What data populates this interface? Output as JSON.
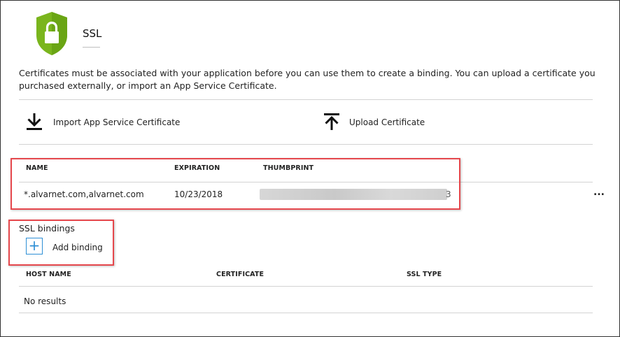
{
  "header": {
    "title": "SSL",
    "icon": "shield-lock-icon",
    "shield_color": "#7ab51d"
  },
  "description": "Certificates must be associated with your application before you can use them to create a binding. You can upload a certificate you purchased externally, or import an App Service Certificate.",
  "toolbar": {
    "import_label": "Import App Service Certificate",
    "import_icon": "download-icon",
    "upload_label": "Upload Certificate",
    "upload_icon": "upload-icon"
  },
  "certificates": {
    "columns": [
      "NAME",
      "EXPIRATION",
      "THUMBPRINT"
    ],
    "rows": [
      {
        "name": "*.alvarnet.com,alvarnet.com",
        "expiration": "10/23/2018",
        "thumbprint_visible_end": "3"
      }
    ],
    "more_label": "..."
  },
  "bindings": {
    "title": "SSL bindings",
    "add_label": "Add binding",
    "add_symbol": "+",
    "columns": [
      "HOST NAME",
      "CERTIFICATE",
      "SSL TYPE"
    ],
    "empty_text": "No results"
  },
  "colors": {
    "highlight": "#e5474c",
    "accent": "#2d8fd5"
  }
}
